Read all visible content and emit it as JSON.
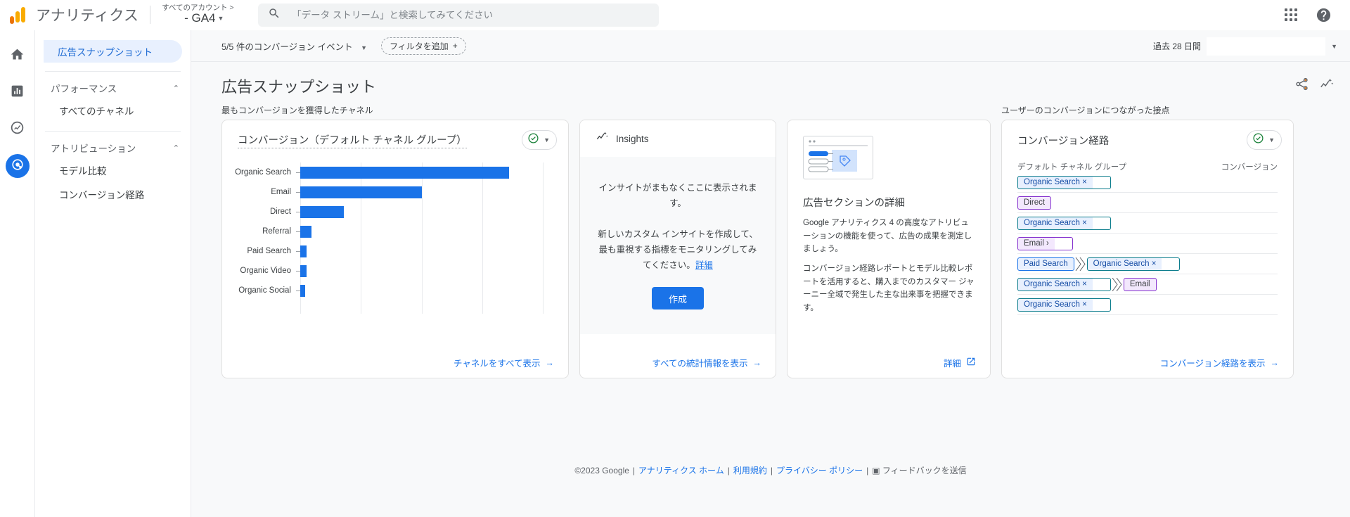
{
  "topbar": {
    "brand": "アナリティクス",
    "account_top": "すべてのアカウント >",
    "account_bottom": "- GA4",
    "search_placeholder": "「データ ストリーム」と検索してみてください",
    "search_value": "",
    "apps_icon": "apps-grid-icon",
    "help_icon": "help-circle-icon",
    "search_icon": "search-icon"
  },
  "rail": {
    "items": [
      {
        "name": "home",
        "icon": "home-icon"
      },
      {
        "name": "reports",
        "icon": "bar-chart-icon"
      },
      {
        "name": "explore",
        "icon": "explore-icon"
      },
      {
        "name": "advertising",
        "icon": "advertising-target-icon"
      }
    ]
  },
  "sidebar": {
    "active_item": "広告スナップショット",
    "groups": [
      {
        "label": "パフォーマンス",
        "collapse_icon": "chevron-up-icon",
        "items": [
          "すべてのチャネル"
        ]
      },
      {
        "label": "アトリビューション",
        "collapse_icon": "chevron-up-icon",
        "items": [
          "モデル比較",
          "コンバージョン経路"
        ]
      }
    ]
  },
  "filterbar": {
    "conversion_events": "5/5 件のコンバージョン イベント",
    "add_filter": "フィルタを追加",
    "add_filter_icon": "plus-icon",
    "date_range": "過去 28 日間",
    "date_caret_icon": "chevron-down-icon"
  },
  "page": {
    "title": "広告スナップショット",
    "share_icon": "share-icon",
    "insights_icon": "insights-sparkline-icon"
  },
  "chart_card": {
    "section_label": "最もコンバージョンを獲得したチャネル",
    "title": "コンバージョン（デフォルト チャネル グループ）",
    "selector_icon": "check-circle-icon",
    "selector_caret_icon": "chevron-down-icon",
    "footer_link": "チャネルをすべて表示",
    "footer_arrow_icon": "arrow-right-icon"
  },
  "chart_data": {
    "type": "bar",
    "orientation": "horizontal",
    "title": "コンバージョン（デフォルト チャネル グループ）",
    "xlabel": "",
    "ylabel": "",
    "categories": [
      "Organic Search",
      "Email",
      "Direct",
      "Referral",
      "Paid Search",
      "Organic Video",
      "Organic Social"
    ],
    "values": [
      86,
      50,
      18,
      4.5,
      2.5,
      2.5,
      2
    ],
    "xlim": [
      0,
      100
    ],
    "gridlines": [
      0,
      25,
      50,
      75,
      100
    ],
    "grid": true,
    "legend": false,
    "bar_color": "#1a73e8"
  },
  "insights_card": {
    "title": "Insights",
    "icon": "insights-sparkline-icon",
    "empty_line1": "インサイトがまもなくここに表示されます。",
    "empty_line2": "新しいカスタム インサイトを作成して、最も重視する指標をモニタリングしてみてください。",
    "learn_more": "詳細",
    "create_button": "作成",
    "footer_link": "すべての統計情報を表示",
    "footer_arrow_icon": "arrow-right-icon"
  },
  "promo_card": {
    "image_icon": "ad-section-illustration",
    "title": "広告セクションの詳細",
    "paragraph1": "Google アナリティクス 4 の高度なアトリビューションの機能を使って、広告の成果を測定しましょう。",
    "paragraph2": "コンバージョン経路レポートとモデル比較レポートを活用すると、購入までのカスタマー ジャーニー全域で発生した主な出来事を把握できます。",
    "footer_link": "詳細",
    "footer_icon": "open-in-new-icon"
  },
  "paths_card": {
    "section_label": "ユーザーのコンバージョンにつながった接点",
    "title": "コンバージョン経路",
    "selector_icon": "check-circle-icon",
    "selector_caret_icon": "chevron-down-icon",
    "col_left": "デフォルト チャネル グループ",
    "col_right": "コンバージョン",
    "footer_link": "コンバージョン経路を表示",
    "footer_arrow_icon": "arrow-right-icon",
    "rows": [
      {
        "steps": [
          {
            "label": "Organic Search ×",
            "style": "teal",
            "box": true
          }
        ]
      },
      {
        "steps": [
          {
            "label": "Direct",
            "style": "purple",
            "box": false
          }
        ]
      },
      {
        "steps": [
          {
            "label": "Organic Search ×",
            "style": "teal",
            "box": true
          }
        ]
      },
      {
        "steps": [
          {
            "label": "Email ›",
            "style": "purple",
            "box": true
          }
        ]
      },
      {
        "steps": [
          {
            "label": "Paid Search",
            "style": "blue",
            "box": false
          },
          {
            "label": "Organic Search ×",
            "style": "teal",
            "box": true
          }
        ]
      },
      {
        "steps": [
          {
            "label": "Organic Search ×",
            "style": "teal",
            "box": true
          },
          {
            "label": "Email",
            "style": "purple",
            "box": false
          }
        ]
      },
      {
        "steps": [
          {
            "label": "Organic Search ×",
            "style": "teal",
            "box": true
          }
        ]
      }
    ]
  },
  "footer": {
    "copyright": "©2023 Google",
    "link_home": "アナリティクス ホーム",
    "link_terms": "利用規約",
    "link_privacy": "プライバシー ポリシー",
    "feedback": "フィードバックを送信",
    "feedback_icon": "feedback-icon"
  }
}
